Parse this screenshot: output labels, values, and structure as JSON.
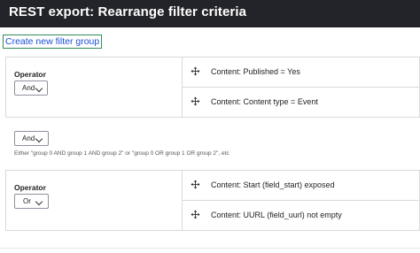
{
  "dialog": {
    "title": "REST export: Rearrange filter criteria"
  },
  "actions": {
    "create_group": "Create new filter group"
  },
  "groups": [
    {
      "operator_label": "Operator",
      "operator_value": "And",
      "filters": [
        {
          "label": "Content: Published = Yes"
        },
        {
          "label": "Content: Content type = Event"
        }
      ]
    },
    {
      "operator_label": "Operator",
      "operator_value": "Or",
      "filters": [
        {
          "label": "Content: Start (field_start) exposed"
        },
        {
          "label": "Content: UURL (field_uurl) not empty"
        }
      ]
    }
  ],
  "between_groups": {
    "operator_value": "And",
    "hint": "Either \"group 0 AND group 1 AND group 2\" or \"group 0 OR group 1 OR group 2\", etc"
  },
  "icons": {
    "drag": "drag-handle-icon",
    "dropdown": "chevron-down-icon"
  }
}
